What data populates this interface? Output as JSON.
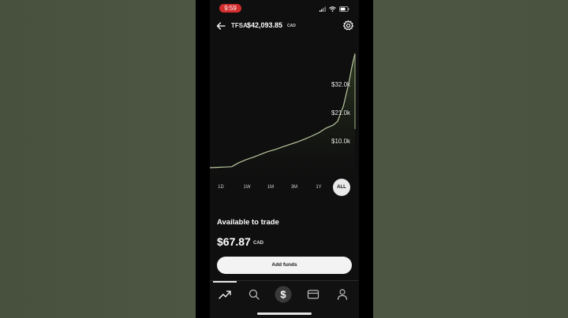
{
  "status_bar": {
    "time": "9:59",
    "colors": {
      "time_pill": "#d12d2d"
    }
  },
  "header": {
    "account_type": "TFSA",
    "balance": "$42,093.85",
    "currency": "CAD",
    "icons": {
      "back": "back-arrow-icon",
      "settings": "gear-icon"
    }
  },
  "chart": {
    "labels": [
      "$32.0k",
      "$21.0k",
      "$10.0k"
    ]
  },
  "chart_data": {
    "type": "area",
    "y_tick_labels": [
      "$32.0k",
      "$21.0k",
      "$10.0k"
    ],
    "yticks": [
      32000,
      21000,
      10000
    ],
    "x": [
      0,
      5,
      10,
      15,
      20,
      25,
      30,
      35,
      40,
      45,
      50,
      55,
      60,
      65,
      70,
      75,
      80,
      85,
      88,
      90,
      92,
      94,
      96,
      98,
      100
    ],
    "values": [
      1000,
      1100,
      1200,
      1300,
      2600,
      3600,
      4400,
      5300,
      6200,
      6900,
      7700,
      8500,
      9300,
      10200,
      11200,
      12300,
      13800,
      14800,
      16000,
      18500,
      21000,
      25000,
      29000,
      34000,
      38000
    ],
    "colors": {
      "line": "#b9c7a0",
      "fill": "#2b3524"
    }
  },
  "ranges": {
    "items": [
      "1D",
      "1W",
      "1M",
      "3M",
      "1Y",
      "ALL"
    ],
    "active": "ALL"
  },
  "trade": {
    "title": "Available to trade",
    "amount": "$67.87",
    "currency": "CAD",
    "button_label": "Add funds"
  },
  "tabs": {
    "icons": [
      "trending-up-icon",
      "search-icon",
      "dollar-icon",
      "card-icon",
      "person-icon"
    ]
  }
}
